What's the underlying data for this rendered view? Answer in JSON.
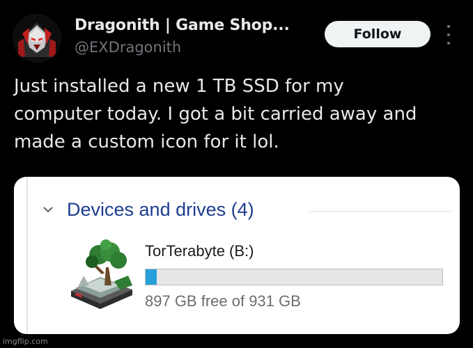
{
  "post": {
    "author": {
      "display_name": "Dragonith | Game Shop...",
      "handle": "@EXDragonith",
      "avatar_icon": "armored-robot-avatar"
    },
    "follow_label": "Follow",
    "more_icon": "more-vertical-icon",
    "text_lines": [
      "Just installed a new 1 TB SSD for my",
      "computer today. I got a bit carried away and",
      "made a custom icon for it lol."
    ]
  },
  "explorer": {
    "section_title": "Devices and drives (4)",
    "section_chevron_icon": "chevron-down-icon",
    "drive": {
      "name": "TorTerabyte (B:)",
      "icon": "tree-island-drive-icon",
      "free_text": "897 GB free of 931 GB",
      "free_gb": 897,
      "total_gb": 931,
      "used_fraction": 0.0365,
      "bar_color": "#26a0da"
    },
    "accent_color": "#1e3d8f"
  },
  "watermark": "imgflip.com"
}
